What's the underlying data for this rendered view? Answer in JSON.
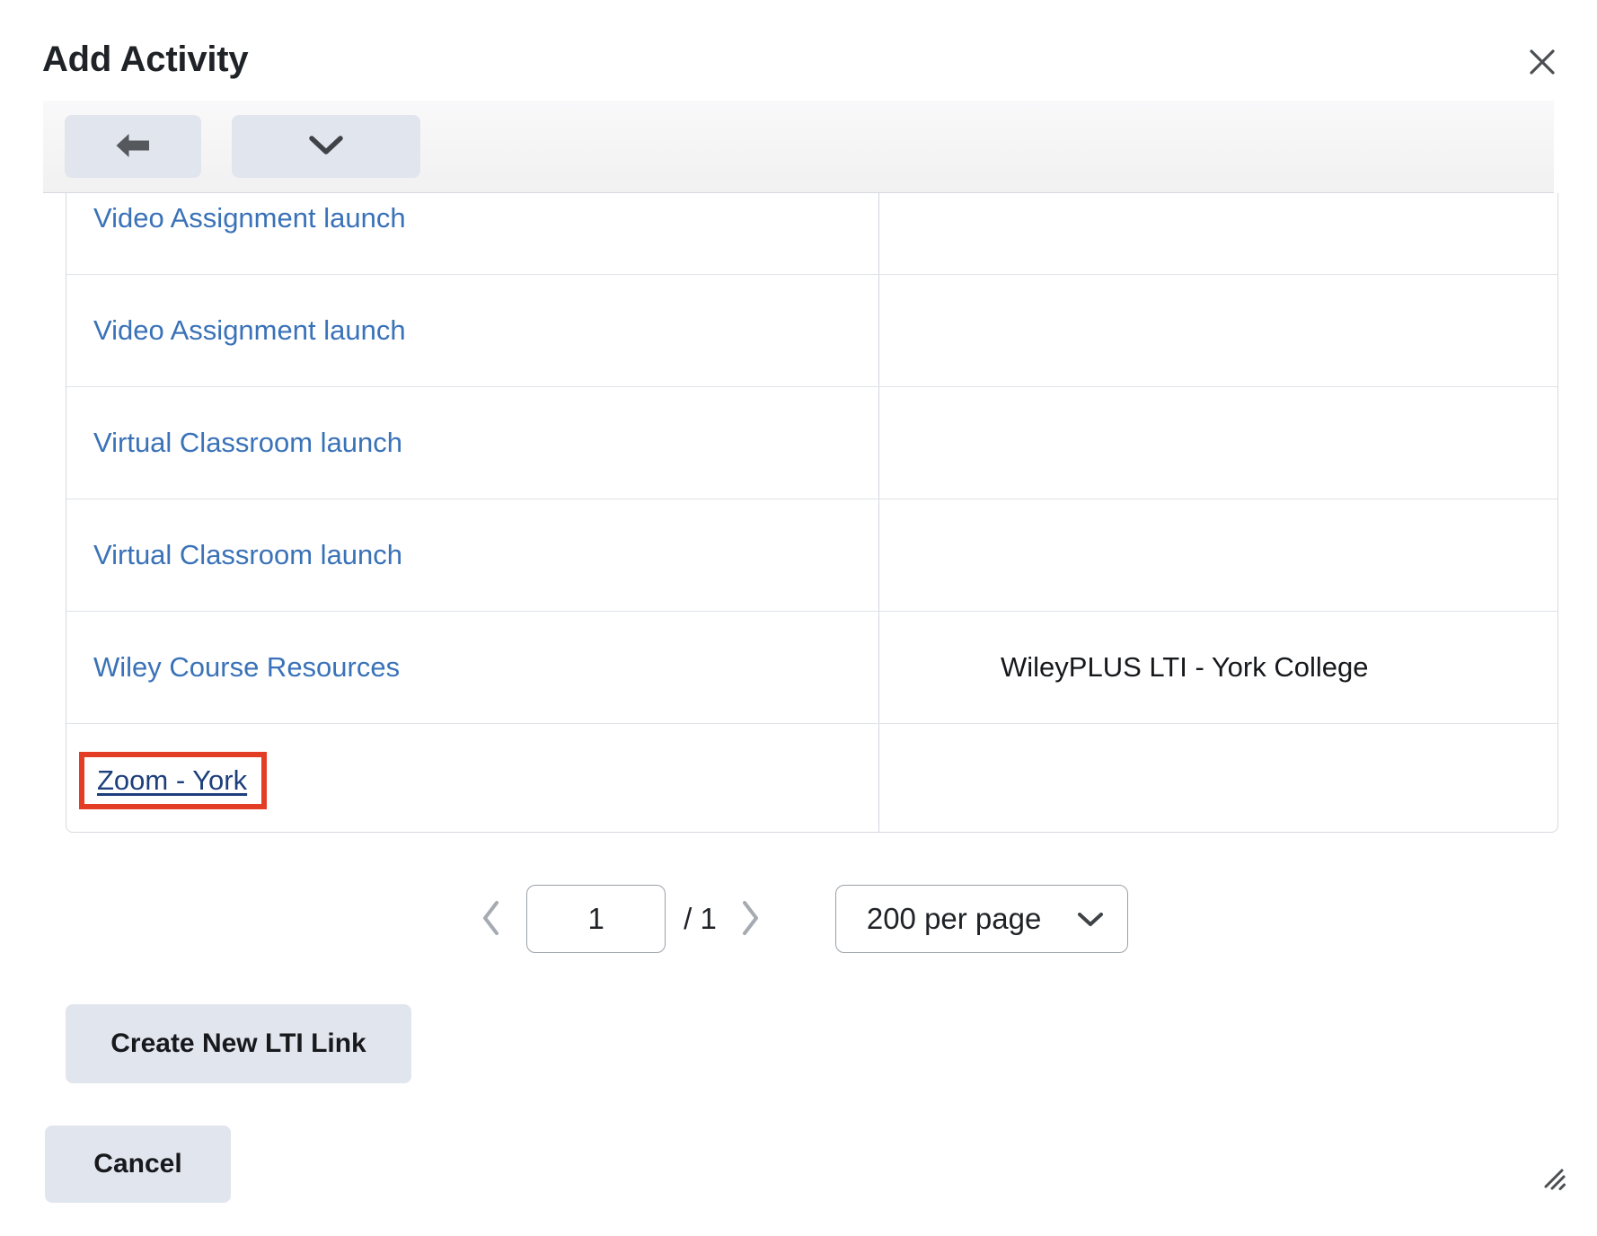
{
  "dialog": {
    "title": "Add Activity",
    "close_label": "Close",
    "close_icon": "close-icon",
    "resize_icon": "resize-handle-icon"
  },
  "toolbar": {
    "back_label": "Back",
    "back_icon": "arrow-left-icon",
    "more_label": "More options",
    "more_icon": "chevron-down-icon"
  },
  "table": {
    "rows": [
      {
        "name": "Video Assignment launch",
        "value": "",
        "state": "default",
        "clipped": true
      },
      {
        "name": "Video Assignment launch",
        "value": "",
        "state": "default",
        "clipped": false
      },
      {
        "name": "Virtual Classroom launch",
        "value": "",
        "state": "default",
        "clipped": false
      },
      {
        "name": "Virtual Classroom launch",
        "value": "",
        "state": "default",
        "clipped": false
      },
      {
        "name": "Wiley Course Resources",
        "value": "WileyPLUS LTI - York College",
        "state": "default",
        "clipped": false
      },
      {
        "name": "Zoom - York",
        "value": "",
        "state": "visited-highlighted",
        "clipped": false
      }
    ]
  },
  "pagination": {
    "prev_icon": "chevron-left-icon",
    "next_icon": "chevron-right-icon",
    "page_value": "1",
    "page_placeholder": "1",
    "total_label": "/ 1",
    "per_page_selected": "200 per page",
    "per_page_icon": "chevron-down-icon",
    "per_page_options": [
      "200 per page"
    ]
  },
  "actions": {
    "create_label": "Create New LTI Link",
    "cancel_label": "Cancel"
  },
  "colors": {
    "link": "#3a72b8",
    "link_visited": "#1d3f7c",
    "highlight_box": "#e43d26",
    "button_bg": "#e1e5ed",
    "toolbar_bg": "#f4f4f5",
    "border": "#d6dae0",
    "text": "#1f2226"
  }
}
